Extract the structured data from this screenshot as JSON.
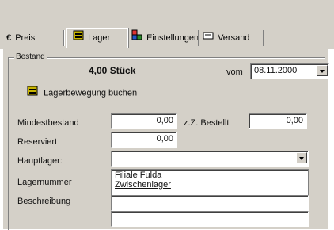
{
  "tabs": [
    {
      "label": "Preis"
    },
    {
      "label": "Lager"
    },
    {
      "label": "Einstellungen"
    },
    {
      "label": "Versand"
    }
  ],
  "bestand": {
    "group_title": "Bestand",
    "quantity_display": "4,00 Stück",
    "date_label": "vom",
    "date_value": "08.11.2000",
    "booking_button": "Lagerbewegung buchen"
  },
  "fields": {
    "mindestbestand_label": "Mindestbestand",
    "mindestbestand_value": "0,00",
    "zz_bestellt_label": "z.Z. Bestellt",
    "zz_bestellt_value": "0,00",
    "reserviert_label": "Reserviert",
    "reserviert_value": "0,00",
    "hauptlager_label": "Hauptlager:",
    "hauptlager_value": "",
    "lagernummer_label": "Lagernummer",
    "lager_options": [
      "Filiale Fulda",
      "Zwischenlager"
    ],
    "beschreibung_label": "Beschreibung",
    "beschreibung_line1": "",
    "beschreibung_line2": ""
  },
  "icons": {
    "preis": "euro-icon",
    "lager": "warehouse-icon",
    "einstellungen": "settings-people-icon",
    "versand": "shipping-icon",
    "booking": "warehouse-icon"
  },
  "colors": {
    "window_bg": "#d4d0c8",
    "field_bg": "#ffffff"
  }
}
